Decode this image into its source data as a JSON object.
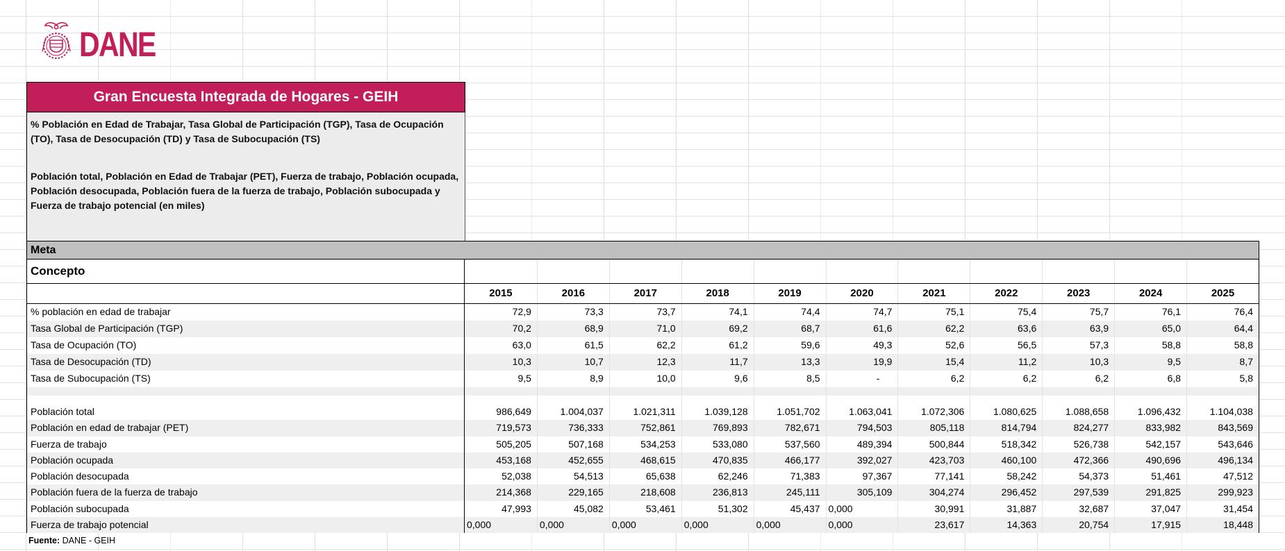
{
  "colors": {
    "accent": "#C11E5A",
    "meta_bar": "#BFBFBF",
    "row_stripe": "#EFEFEF"
  },
  "brand": {
    "wordmark": "DANE"
  },
  "header": {
    "title": "Gran Encuesta Integrada de Hogares - GEIH",
    "subtitle_rates": "% Población en Edad de Trabajar, Tasa Global de Participación (TGP), Tasa de Ocupación (TO), Tasa de Desocupación (TD) y Tasa de Subocupación (TS)",
    "subtitle_counts": "Población total, Población en Edad de Trabajar (PET), Fuerza de trabajo, Población ocupada, Población desocupada, Población fuera de la fuerza de trabajo, Población subocupada y Fuerza de trabajo potencial (en miles)"
  },
  "region_label": "Meta",
  "table": {
    "corner_label": "Concepto",
    "years": [
      "2015",
      "2016",
      "2017",
      "2018",
      "2019",
      "2020",
      "2021",
      "2022",
      "2023",
      "2024",
      "2025"
    ],
    "rate_rows": [
      {
        "label": "% población en edad de trabajar",
        "values": [
          "72,9",
          "73,3",
          "73,7",
          "74,1",
          "74,4",
          "74,7",
          "75,1",
          "75,4",
          "75,7",
          "76,1",
          "76,4"
        ]
      },
      {
        "label": "Tasa Global de Participación (TGP)",
        "values": [
          "70,2",
          "68,9",
          "71,0",
          "69,2",
          "68,7",
          "61,6",
          "62,2",
          "63,6",
          "63,9",
          "65,0",
          "64,4"
        ]
      },
      {
        "label": "Tasa de Ocupación (TO)",
        "values": [
          "63,0",
          "61,5",
          "62,2",
          "61,2",
          "59,6",
          "49,3",
          "52,6",
          "56,5",
          "57,3",
          "58,8",
          "58,8"
        ]
      },
      {
        "label": "Tasa de Desocupación (TD)",
        "values": [
          "10,3",
          "10,7",
          "12,3",
          "11,7",
          "13,3",
          "19,9",
          "15,4",
          "11,2",
          "10,3",
          "9,5",
          "8,7"
        ]
      },
      {
        "label": "Tasa de Subocupación (TS)",
        "values": [
          "9,5",
          "8,9",
          "10,0",
          "9,6",
          "8,5",
          "-",
          "6,2",
          "6,2",
          "6,2",
          "6,8",
          "5,8"
        ]
      }
    ],
    "count_rows": [
      {
        "label": "Población total",
        "values": [
          "986,649",
          "1.004,037",
          "1.021,311",
          "1.039,128",
          "1.051,702",
          "1.063,041",
          "1.072,306",
          "1.080,625",
          "1.088,658",
          "1.096,432",
          "1.104,038"
        ]
      },
      {
        "label": "Población en edad de trabajar (PET)",
        "values": [
          "719,573",
          "736,333",
          "752,861",
          "769,893",
          "782,671",
          "794,503",
          "805,118",
          "814,794",
          "824,277",
          "833,982",
          "843,569"
        ]
      },
      {
        "label": "Fuerza de trabajo",
        "values": [
          "505,205",
          "507,168",
          "534,253",
          "533,080",
          "537,560",
          "489,394",
          "500,844",
          "518,342",
          "526,738",
          "542,157",
          "543,646"
        ]
      },
      {
        "label": "Población ocupada",
        "values": [
          "453,168",
          "452,655",
          "468,615",
          "470,835",
          "466,177",
          "392,027",
          "423,703",
          "460,100",
          "472,366",
          "490,696",
          "496,134"
        ]
      },
      {
        "label": "Población desocupada",
        "values": [
          "52,038",
          "54,513",
          "65,638",
          "62,246",
          "71,383",
          "97,367",
          "77,141",
          "58,242",
          "54,373",
          "51,461",
          "47,512"
        ]
      },
      {
        "label": "Población fuera de la fuerza de trabajo",
        "values": [
          "214,368",
          "229,165",
          "218,608",
          "236,813",
          "245,111",
          "305,109",
          "304,274",
          "296,452",
          "297,539",
          "291,825",
          "299,923"
        ]
      },
      {
        "label": "Población subocupada",
        "values": [
          "47,993",
          "45,082",
          "53,461",
          "51,302",
          "45,437",
          "0,000",
          "30,991",
          "31,887",
          "32,687",
          "37,047",
          "31,454"
        ]
      },
      {
        "label": "Fuerza de trabajo potencial",
        "values": [
          "0,000",
          "0,000",
          "0,000",
          "0,000",
          "0,000",
          "0,000",
          "23,617",
          "14,363",
          "20,754",
          "17,915",
          "18,448"
        ]
      }
    ]
  },
  "footer": {
    "source_label": "Fuente:",
    "source_value": " DANE - GEIH"
  }
}
